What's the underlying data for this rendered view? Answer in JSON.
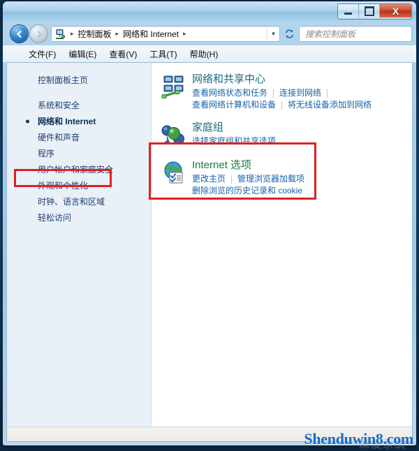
{
  "window": {
    "title": "",
    "buttons": {
      "minimize": "minimize",
      "maximize": "maximize",
      "close": "X"
    }
  },
  "navbar": {
    "back_label": "←",
    "forward_label": "→",
    "recent_dropdown": "▼",
    "breadcrumb": [
      "控制面板",
      "网络和 Internet"
    ],
    "breadcrumb_separator": "▸",
    "breadcrumb_trailing_separator": "▸",
    "address_chevron": "▼",
    "refresh_label": "refresh"
  },
  "search": {
    "placeholder": "搜索控制面板",
    "value": ""
  },
  "menu": {
    "items": [
      "文件(F)",
      "编辑(E)",
      "查看(V)",
      "工具(T)",
      "帮助(H)"
    ]
  },
  "sidebar": {
    "home": "控制面板主页",
    "items": [
      {
        "label": "系统和安全",
        "current": false
      },
      {
        "label": "网络和 Internet",
        "current": true
      },
      {
        "label": "硬件和声音",
        "current": false
      },
      {
        "label": "程序",
        "current": false
      },
      {
        "label": "用户帐户和家庭安全",
        "current": false
      },
      {
        "label": "外观和个性化",
        "current": false
      },
      {
        "label": "时钟、语言和区域",
        "current": false
      },
      {
        "label": "轻松访问",
        "current": false
      }
    ]
  },
  "content": {
    "categories": [
      {
        "icon": "network-sharing-icon",
        "title": "网络和共享中心",
        "title_color": "#18687f",
        "links_rows": [
          [
            "查看网络状态和任务",
            "连接到网络"
          ],
          [
            "查看网络计算机和设备",
            "将无线设备添加到网络"
          ]
        ]
      },
      {
        "icon": "homegroup-icon",
        "title": "家庭组",
        "title_color": "#18687f",
        "links_rows": [
          [
            "选择家庭组和共享选项"
          ]
        ]
      },
      {
        "icon": "internet-options-icon",
        "title": "Internet 选项",
        "title_color": "#1a7a3c",
        "links_rows": [
          [
            "更改主页",
            "管理浏览器加载项"
          ],
          [
            "删除浏览的历史记录和 cookie"
          ]
        ]
      }
    ]
  },
  "annotations": {
    "highlight_color": "#e02020",
    "sidebar_target": "网络和 Internet",
    "content_target": "Internet 选项"
  },
  "watermark": {
    "text": "Shenduwin8.com",
    "color": "#1769c8",
    "ghost_text": "深度系统"
  }
}
